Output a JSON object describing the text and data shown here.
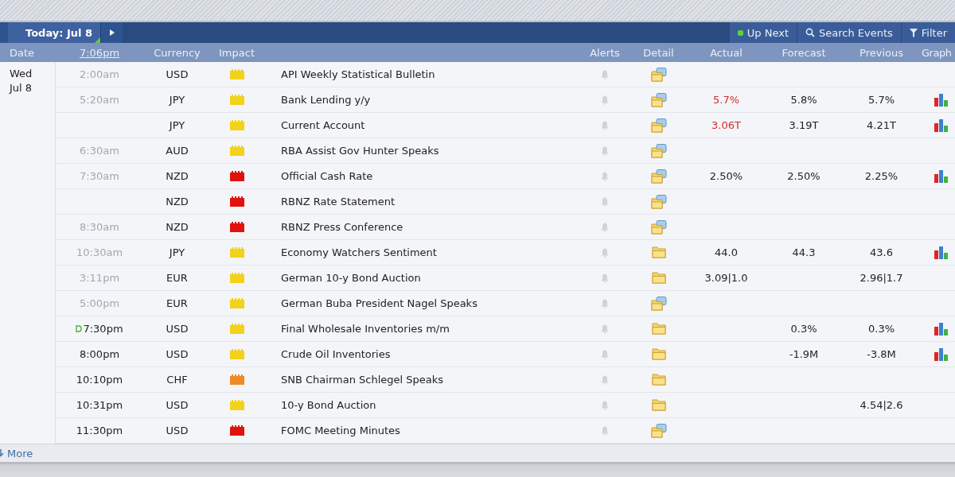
{
  "toolbar": {
    "today_label": "Today: Jul 8",
    "buttons": [
      {
        "kind": "upnext",
        "label": "Up Next"
      },
      {
        "kind": "search",
        "label": "Search Events"
      },
      {
        "kind": "filter",
        "label": "Filter"
      }
    ]
  },
  "columns": [
    "Date",
    "7:06pm",
    "Currency",
    "Impact",
    "",
    "Alerts",
    "Detail",
    "Actual",
    "Forecast",
    "Previous",
    "Graph"
  ],
  "day": "Wed Jul 8",
  "rows": [
    {
      "time": "2:00am",
      "past": true,
      "up_next": false,
      "currency": "USD",
      "color": "#f2d21b",
      "event": "API Weekly Statistical Bulletin",
      "detail_story": true,
      "graph": false
    },
    {
      "time": "5:20am",
      "past": true,
      "up_next": false,
      "currency": "JPY",
      "color": "#f2d21b",
      "event": "Bank Lending y/y",
      "detail_story": true,
      "actual": "5.7%",
      "actual_worse": true,
      "forecast": "5.8%",
      "previous": "5.7%",
      "graph": true
    },
    {
      "up_next": false,
      "currency": "JPY",
      "color": "#f2d21b",
      "event": "Current Account",
      "detail_story": true,
      "actual": "3.06T",
      "actual_worse": true,
      "forecast": "3.19T",
      "previous": "4.21T",
      "graph": true
    },
    {
      "time": "6:30am",
      "past": true,
      "up_next": false,
      "currency": "AUD",
      "color": "#f2d21b",
      "event": "RBA Assist Gov Hunter Speaks",
      "detail_story": true,
      "graph": false
    },
    {
      "time": "7:30am",
      "past": true,
      "up_next": false,
      "currency": "NZD",
      "color": "#e0120f",
      "event": "Official Cash Rate",
      "detail_story": true,
      "actual": "2.50%",
      "actual_worse": false,
      "forecast": "2.50%",
      "previous": "2.25%",
      "graph": true
    },
    {
      "up_next": false,
      "currency": "NZD",
      "color": "#e0120f",
      "event": "RBNZ Rate Statement",
      "detail_story": true,
      "graph": false
    },
    {
      "time": "8:30am",
      "past": true,
      "up_next": false,
      "currency": "NZD",
      "color": "#e0120f",
      "event": "RBNZ Press Conference",
      "detail_story": true,
      "graph": false
    },
    {
      "time": "10:30am",
      "past": true,
      "up_next": false,
      "currency": "JPY",
      "color": "#f2d21b",
      "event": "Economy Watchers Sentiment",
      "detail_story": false,
      "actual": "44.0",
      "actual_worse": false,
      "forecast": "44.3",
      "previous": "43.6",
      "graph": true
    },
    {
      "time": "3:11pm",
      "past": true,
      "up_next": false,
      "currency": "EUR",
      "color": "#f2d21b",
      "event": "German 10-y Bond Auction",
      "detail_story": false,
      "actual": "3.09|1.0",
      "actual_worse": false,
      "previous": "2.96|1.7",
      "graph": false
    },
    {
      "time": "5:00pm",
      "past": true,
      "up_next": false,
      "currency": "EUR",
      "color": "#f2d21b",
      "event": "German Buba President Nagel Speaks",
      "detail_story": true,
      "graph": false
    },
    {
      "time": "7:30pm",
      "past": false,
      "up_next": true,
      "currency": "USD",
      "color": "#f2d21b",
      "event": "Final Wholesale Inventories m/m",
      "detail_story": false,
      "forecast": "0.3%",
      "previous": "0.3%",
      "graph": true
    },
    {
      "time": "8:00pm",
      "past": false,
      "up_next": false,
      "currency": "USD",
      "color": "#f2d21b",
      "event": "Crude Oil Inventories",
      "detail_story": false,
      "forecast": "-1.9M",
      "previous": "-3.8M",
      "graph": true
    },
    {
      "time": "10:10pm",
      "past": false,
      "up_next": false,
      "currency": "CHF",
      "color": "#f08a24",
      "event": "SNB Chairman Schlegel Speaks",
      "detail_story": false,
      "graph": false
    },
    {
      "time": "10:31pm",
      "past": false,
      "up_next": false,
      "currency": "USD",
      "color": "#f2d21b",
      "event": "10-y Bond Auction",
      "detail_story": false,
      "previous": "4.54|2.6",
      "graph": false
    },
    {
      "time": "11:30pm",
      "past": false,
      "up_next": false,
      "currency": "USD",
      "color": "#e0120f",
      "event": "FOMC Meeting Minutes",
      "detail_story": true,
      "graph": false
    }
  ],
  "footer": {
    "more_label": "More"
  }
}
